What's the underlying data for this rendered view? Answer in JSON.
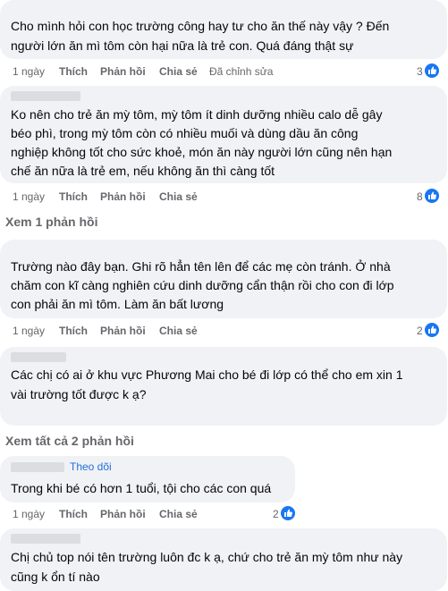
{
  "actions": {
    "like": "Thích",
    "reply": "Phản hồi",
    "share": "Chia sẻ"
  },
  "colors": {
    "bubble": "#f0f2f5",
    "link": "#216fdb",
    "muted": "#65676b",
    "like": "#1877f2"
  },
  "comments": [
    {
      "lines": [
        "Cho mình hỏi con học trường công hay tư cho ăn thế này vậy ? Đến",
        "người lớn ăn mì tôm còn hại nữa là trẻ con. Quá đáng thật sự"
      ],
      "time": "1 ngày",
      "edited": "Đã chỉnh sửa",
      "reactions": "3"
    },
    {
      "lines": [
        "Ko nên cho trẻ ăn mỳ tôm, mỳ tôm ít dinh dưỡng nhiều calo dễ gây",
        "béo phì, trong mỳ tôm còn có nhiều muối và dùng dầu ăn công",
        "nghiệp không tốt cho sức khoẻ, món ăn này người lớn cũng nên hạn",
        "chế ăn nữa là trẻ em, nếu không ăn thì càng tốt"
      ],
      "time": "1 ngày",
      "reactions": "8"
    },
    {
      "lines": [
        "Trường nào đây bạn. Ghi rõ hẳn tên lên để các mẹ còn tránh. Ở nhà",
        "chăm con kĩ càng nghiên cứu dinh dưỡng cẩn thận rồi cho con đi lớp",
        "con phải ăn mì tôm. Làm ăn bất lương"
      ],
      "time": "1 ngày",
      "reactions": "2"
    },
    {
      "lines": [
        "Các chị có ai ở khu vực Phương Mai cho bé đi lớp có thể cho em xin 1",
        "vài trường tốt được k ạ?"
      ],
      "time": "1 ngày"
    },
    {
      "follow": "Theo dõi",
      "lines": [
        "Trong khi bé có hơn 1 tuổi, tội cho các con quá"
      ],
      "time": "1 ngày",
      "reactions": "2"
    },
    {
      "lines": [
        "Chị chủ top nói tên trường luôn đc k ạ, chứ cho trẻ ăn mỳ tôm như này",
        "cũng k ổn tí nào"
      ]
    }
  ],
  "replies": {
    "one": "Xem 1 phản hồi",
    "all": "Xem tất cả 2 phản hồi"
  }
}
